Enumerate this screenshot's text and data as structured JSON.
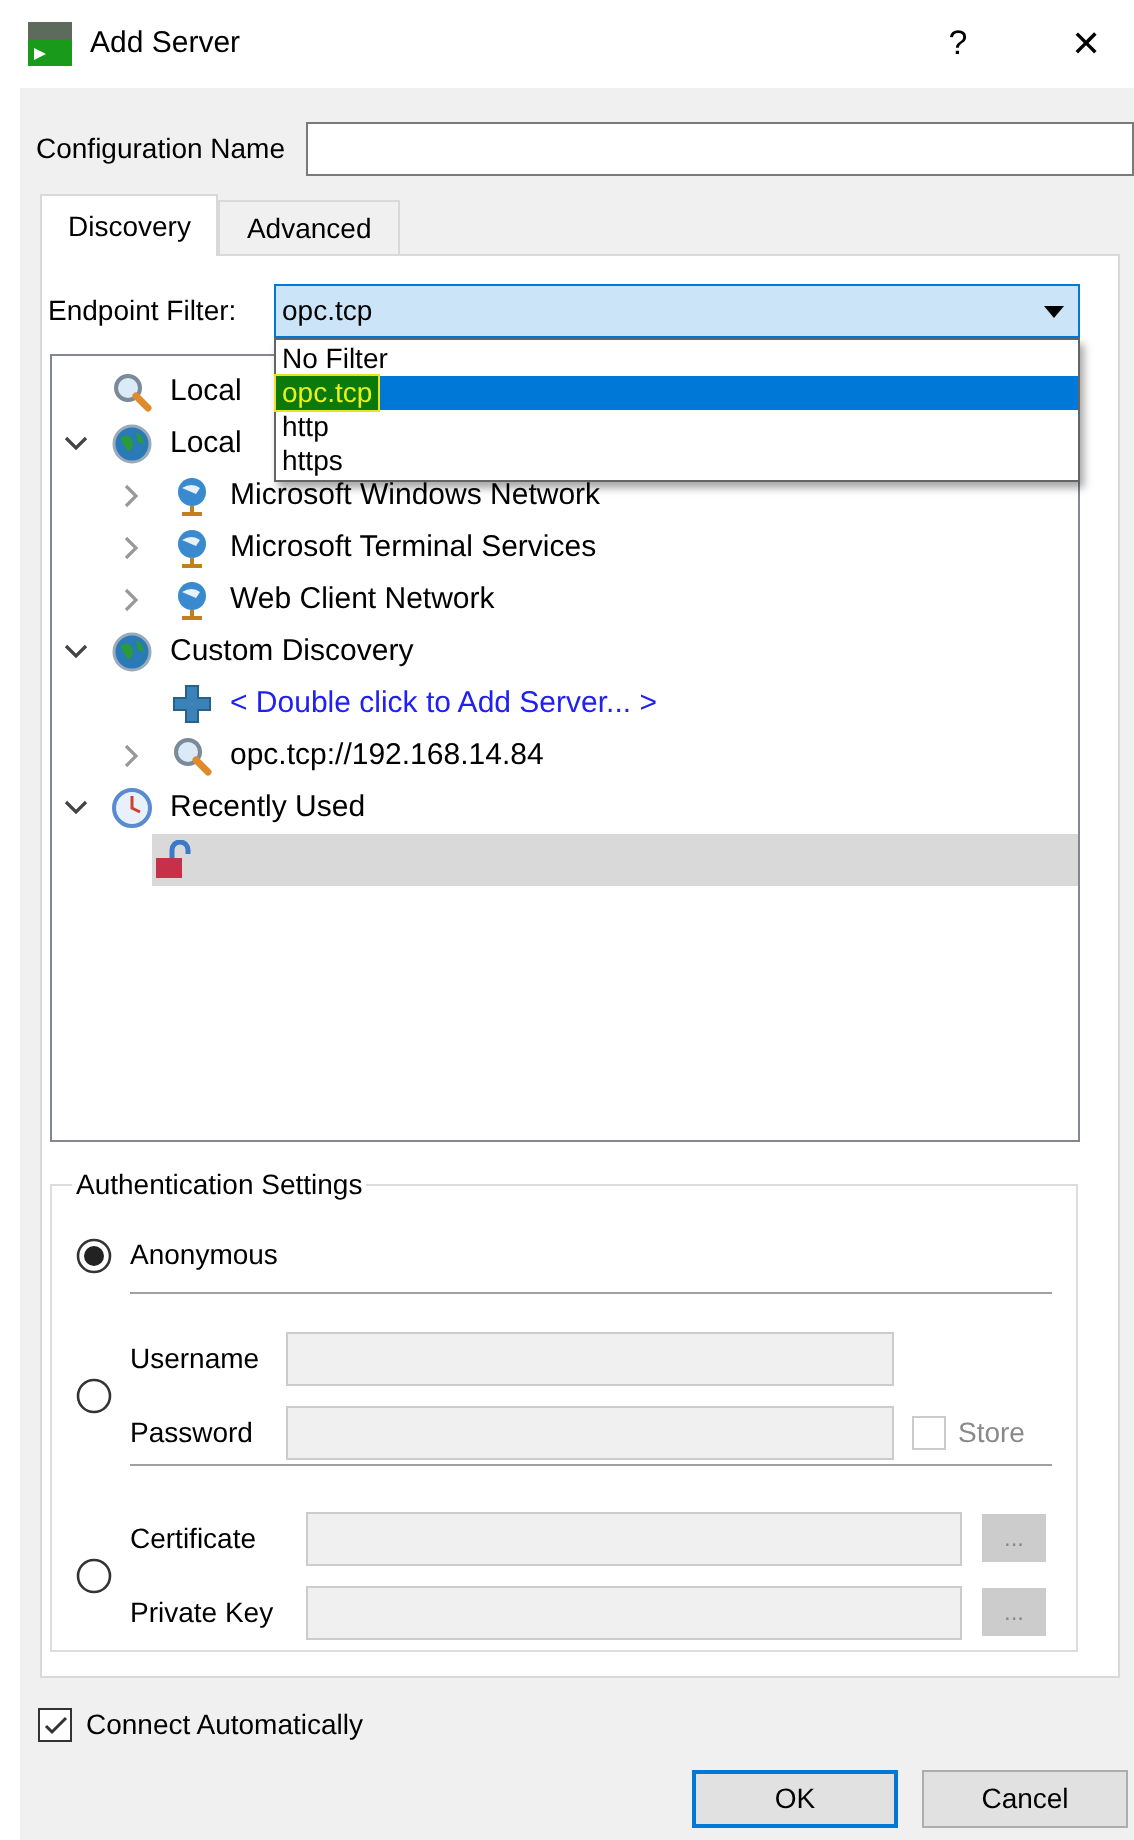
{
  "window": {
    "title": "Add Server",
    "help": "?",
    "close": "✕"
  },
  "config_name": {
    "label": "Configuration Name"
  },
  "tabs": [
    {
      "label": "Discovery",
      "selected": true
    },
    {
      "label": "Advanced",
      "selected": false
    }
  ],
  "endpoint_filter": {
    "label": "Endpoint Filter:",
    "value": "opc.tcp",
    "options": [
      {
        "label": "No Filter",
        "selected": false
      },
      {
        "label": "opc.tcp",
        "selected": true
      },
      {
        "label": "http",
        "selected": false
      },
      {
        "label": "https",
        "selected": false
      }
    ]
  },
  "tree": [
    {
      "label": "Local",
      "kind": "search",
      "selected": false
    },
    {
      "label": "Local",
      "kind": "globe",
      "expanded": true,
      "selected": false,
      "children": [
        {
          "label": "Microsoft Windows Network",
          "kind": "network",
          "expanded": false,
          "selected": false
        },
        {
          "label": "Microsoft Terminal Services",
          "kind": "network",
          "expanded": false,
          "selected": false
        },
        {
          "label": "Web Client Network",
          "kind": "network",
          "expanded": false,
          "selected": false
        }
      ]
    },
    {
      "label": "Custom Discovery",
      "kind": "globe",
      "expanded": true,
      "selected": false,
      "children": [
        {
          "label": "< Double click to Add Server... >",
          "kind": "link",
          "selected": false
        },
        {
          "label": "opc.tcp://192.168.14.84",
          "kind": "search",
          "expanded": false,
          "selected": false
        }
      ]
    },
    {
      "label": "Recently Used",
      "kind": "clock",
      "expanded": true,
      "selected": false,
      "children": [
        {
          "kind": "lock",
          "selected": true
        }
      ]
    }
  ],
  "auth": {
    "title": "Authentication Settings",
    "options": [
      {
        "selected": true,
        "label": "Anonymous"
      },
      {
        "selected": false,
        "fields": [
          {
            "label": "Username",
            "disabled": true
          },
          {
            "label": "Password",
            "disabled": true,
            "store": {
              "label": "Store",
              "checked": false,
              "disabled": true
            }
          }
        ]
      },
      {
        "selected": false,
        "fields": [
          {
            "label": "Certificate",
            "disabled": true,
            "browse": "..."
          },
          {
            "label": "Private Key",
            "disabled": true,
            "browse": "..."
          }
        ]
      }
    ]
  },
  "connect_automatically": {
    "label": "Connect Automatically",
    "checked": true
  },
  "buttons": [
    {
      "label": "OK",
      "default": true
    },
    {
      "label": "Cancel",
      "default": false
    }
  ]
}
